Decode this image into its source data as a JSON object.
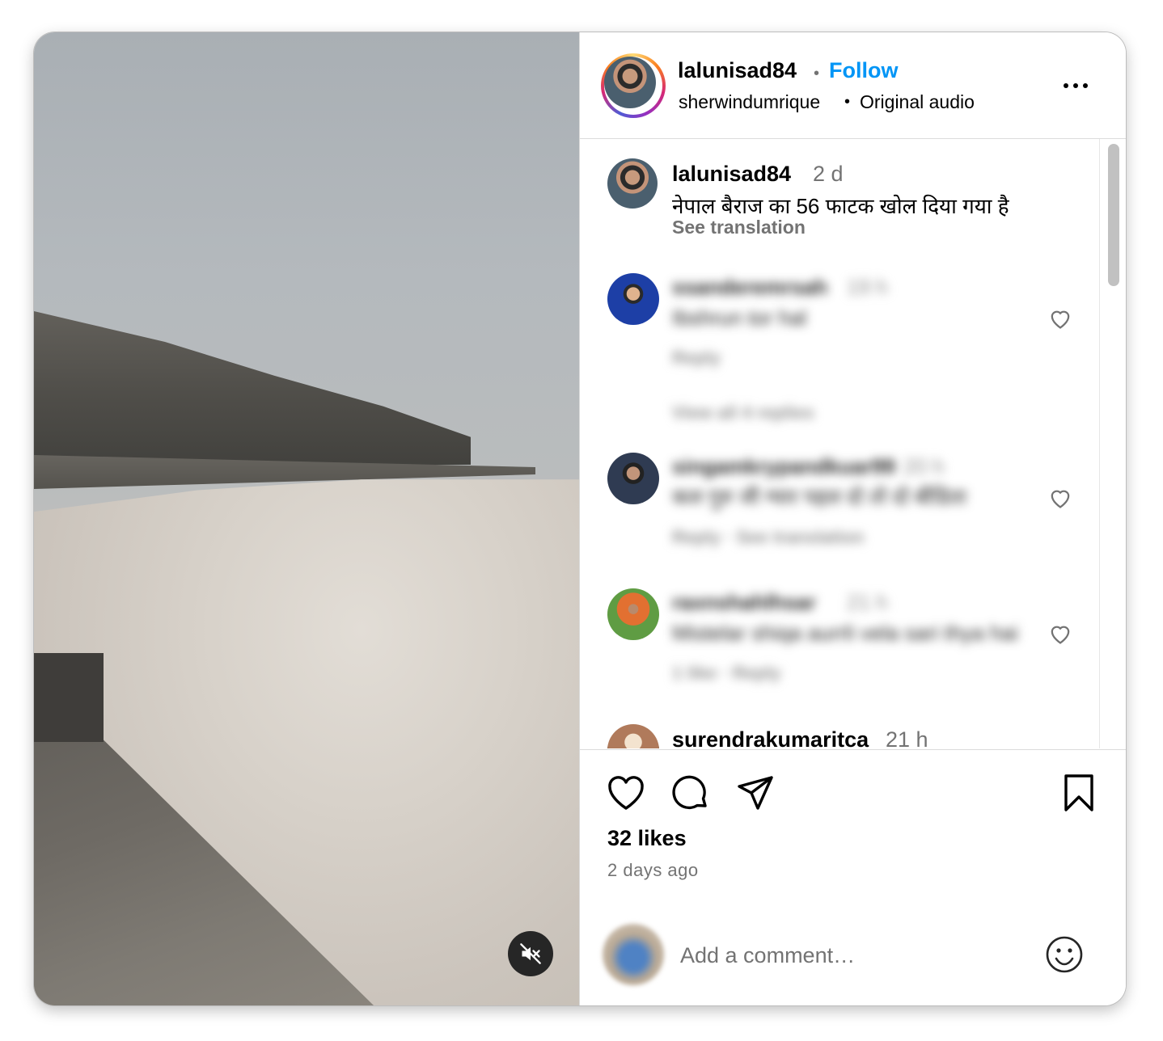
{
  "post": {
    "author": "lalunisad84",
    "follow_label": "Follow",
    "separator": "•",
    "audio_user": "sherwindumrique",
    "audio_label": "Original audio"
  },
  "caption": {
    "user": "lalunisad84",
    "time": "2 d",
    "text": "नेपाल बैराज का 56 फाटक खोल दिया गया है",
    "see_translation": "See translation"
  },
  "comments": [
    {
      "user": "ssanderemrsah",
      "time": "19 h",
      "text": "Ibshrun tor hal",
      "meta": "Reply",
      "replies": "View all 4 replies"
    },
    {
      "user": "singamkrypandkuar99",
      "time": "20 h",
      "text": "कल गुरु जी ग्यार पहल दो तो दो बीडिता",
      "meta": "Reply · See translation"
    },
    {
      "user": "raxnshahlhsar",
      "time": "21 h",
      "text": "Mistelar shiqa aurrli vela sari thya hai",
      "meta": "1 like · Reply"
    },
    {
      "user": "surendrakumaritca",
      "time": "21 h"
    }
  ],
  "actions": {
    "likes": "32 likes",
    "date": "2 days ago"
  },
  "comment_box": {
    "placeholder": "Add a comment…"
  },
  "icons": {
    "more": "more-options-icon",
    "like": "heart-icon",
    "comment": "comment-bubble-icon",
    "share": "share-paper-plane-icon",
    "save": "bookmark-icon",
    "mute": "speaker-muted-icon",
    "emoji": "emoji-smiley-icon"
  },
  "colors": {
    "follow": "#0095f6",
    "muted_text": "#737373",
    "divider": "#dbdbdb"
  }
}
